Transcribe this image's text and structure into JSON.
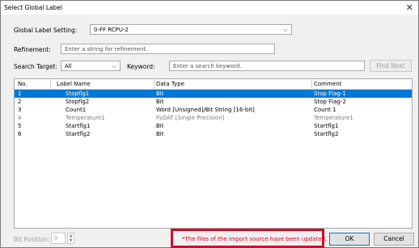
{
  "window": {
    "title": "Select Global Label",
    "close_symbol": "✕"
  },
  "global_label_setting": {
    "label": "Global Label Setting:",
    "value": "0-FF RCPU-2"
  },
  "refinement": {
    "label": "Refinement:",
    "placeholder": "Enter a string for refinement."
  },
  "search_target": {
    "label": "Search Target:",
    "value": "All"
  },
  "keyword": {
    "label": "Keyword:",
    "placeholder": "Enter a search keyword."
  },
  "find_next_button": "Find Next",
  "table": {
    "columns": [
      "No.",
      "Label Name",
      "Data Type",
      "Comment"
    ],
    "rows": [
      {
        "no": "1",
        "label_name": "Stopflg1",
        "data_type": "Bit",
        "comment": "Stop Flag-1",
        "selected": true,
        "disabled": false
      },
      {
        "no": "2",
        "label_name": "Stopflg2",
        "data_type": "Bit",
        "comment": "Stop Flag-2",
        "selected": false,
        "disabled": false
      },
      {
        "no": "3",
        "label_name": "Count1",
        "data_type": "Word [Unsigned]/Bit String [16-bit]",
        "comment": "Count 1",
        "selected": false,
        "disabled": false
      },
      {
        "no": "4",
        "label_name": "Temperature1",
        "data_type": "FLOAT [Single Precision]",
        "comment": "Temperature1",
        "selected": false,
        "disabled": true
      },
      {
        "no": "5",
        "label_name": "Startflg1",
        "data_type": "Bit",
        "comment": "Startflg1",
        "selected": false,
        "disabled": false
      },
      {
        "no": "6",
        "label_name": "Startflg2",
        "data_type": "Bit",
        "comment": "Startflg2",
        "selected": false,
        "disabled": false
      }
    ]
  },
  "bit_position": {
    "label": "Bit Position:",
    "value": "0"
  },
  "status_message": "*The files of the import source have been updated.",
  "ok_button": "OK",
  "cancel_button": "Cancel",
  "colors": {
    "selection": "#0078d7",
    "highlight_box": "#c8102e",
    "message": "#e8001c"
  },
  "icons": {
    "dropdown": "chevron-down-icon",
    "spin": "spin-arrows-icon",
    "close": "close-icon"
  }
}
